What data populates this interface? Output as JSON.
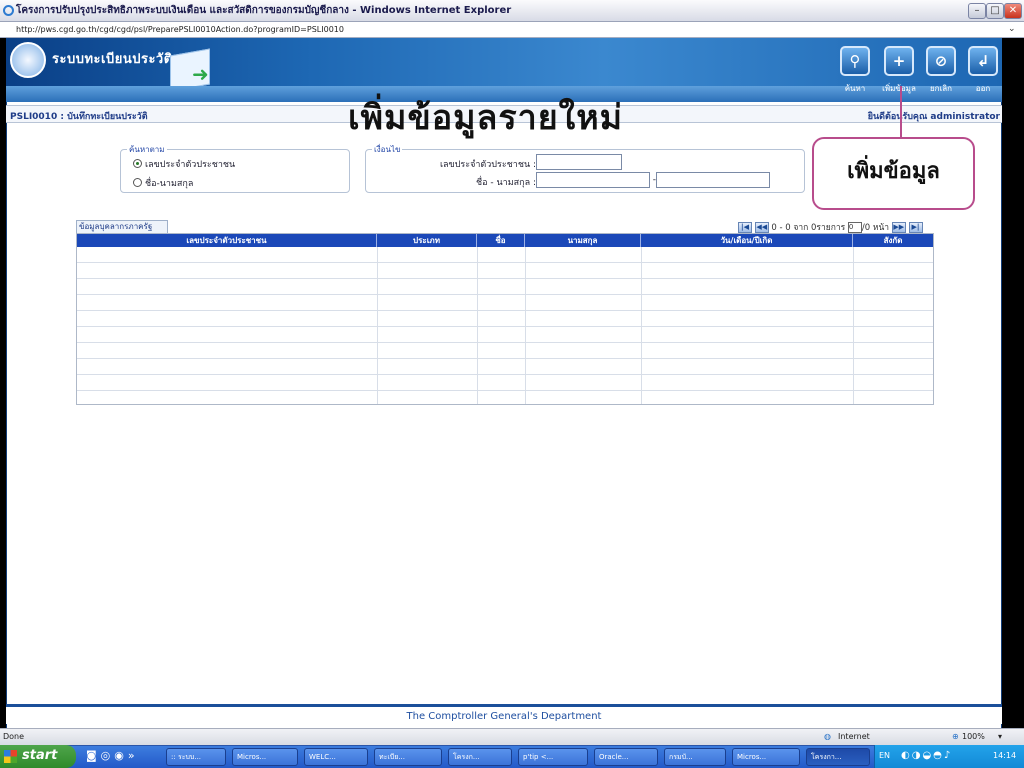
{
  "window": {
    "title": "โครงการปรับปรุงประสิทธิภาพระบบเงินเดือน และสวัสดิการของกรมบัญชีกลาง - Windows Internet Explorer",
    "address": "http://pws.cgd.go.th/cgd/cgd/psl/PreparePSLI0010Action.do?programID=PSLI0010"
  },
  "banner": {
    "system_name": "ระบบทะเบียนประวัติ",
    "toolbar": [
      {
        "label": "ค้นหา",
        "icon": "search-icon",
        "glyph": "⚲"
      },
      {
        "label": "เพิ่มข้อมูล",
        "icon": "plus-icon",
        "glyph": "+"
      },
      {
        "label": "ยกเลิก",
        "icon": "cancel-icon",
        "glyph": "⊘"
      },
      {
        "label": "ออก",
        "icon": "exit-icon",
        "glyph": "↲"
      }
    ]
  },
  "page": {
    "program_title": "PSLI0010 : บันทึกทะเบียนประวัติ",
    "welcome": "ยินดีต้อนรับคุณ administrator",
    "overlay_title": "เพิ่มข้อมูลรายใหม่",
    "callout_text": "เพิ่มข้อมูล"
  },
  "search": {
    "legend": "ค้นหาตาม",
    "options": [
      {
        "label": "เลขประจำตัวประชาชน",
        "selected": true
      },
      {
        "label": "ชื่อ-นามสกุล",
        "selected": false
      }
    ]
  },
  "conditions": {
    "legend": "เงื่อนไข",
    "id_label": "เลขประจำตัวประชาชน :",
    "name_label": "ชื่อ - นามสกุล :",
    "dash": "-"
  },
  "grid": {
    "tab_label": "ข้อมูลบุคลากรภาครัฐ",
    "pager": {
      "summary": "0 - 0 จาก 0รายการ",
      "page_value": "0",
      "page_total": "/0 หน้า"
    },
    "columns": [
      "เลขประจำตัวประชาชน",
      "ประเภท",
      "ชื่อ",
      "นามสกุล",
      "วัน/เดือน/ปีเกิด",
      "สังกัด"
    ],
    "rows": []
  },
  "footer": {
    "text": "The Comptroller General's Department"
  },
  "statusbar": {
    "left": "Done",
    "zone": "Internet",
    "zoom": "100%"
  },
  "taskbar": {
    "start": "start",
    "tasks": [
      ":: ระบบ...",
      "Micros...",
      "WELC...",
      "ทะเบีย...",
      "โครงก...",
      "p'tip <...",
      "Oracle...",
      "กรมบั...",
      "Micros...",
      "โครงกา..."
    ],
    "lang": "EN",
    "clock": "14:14"
  },
  "colors": {
    "header_blue": "#1b48b8",
    "banner_blue": "#1d67b3",
    "callout_border": "#b84c8c"
  }
}
